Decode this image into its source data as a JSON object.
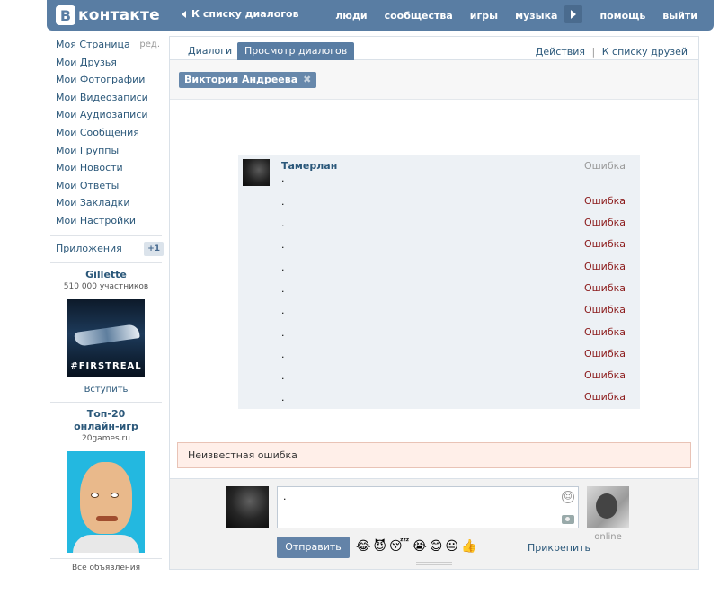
{
  "header": {
    "logo_letter": "В",
    "logo_text": "контакте",
    "back_label": "К списку диалогов",
    "nav": [
      "люди",
      "сообщества",
      "игры",
      "музыка",
      "помощь",
      "выйти"
    ]
  },
  "sidebar": {
    "items": [
      {
        "label": "Моя Страница"
      },
      {
        "label": "Мои Друзья"
      },
      {
        "label": "Мои Фотографии"
      },
      {
        "label": "Мои Видеозаписи"
      },
      {
        "label": "Мои Аудиозаписи"
      },
      {
        "label": "Мои Сообщения"
      },
      {
        "label": "Мои Группы"
      },
      {
        "label": "Мои Новости"
      },
      {
        "label": "Мои Ответы"
      },
      {
        "label": "Мои Закладки"
      },
      {
        "label": "Мои Настройки"
      }
    ],
    "edit_label": "ред.",
    "apps_label": "Приложения",
    "apps_count": "+1"
  },
  "ads": [
    {
      "title": "Gillette",
      "subtitle": "510 000 участников",
      "image_tag": "#FIRSTREAL",
      "link": "Вступить"
    },
    {
      "title": "Топ-20 онлайн-игр",
      "subtitle": "20games.ru"
    }
  ],
  "ads_footer": "Все объявления",
  "tabs": [
    {
      "label": "Диалоги",
      "active": false
    },
    {
      "label": "Просмотр диалогов",
      "active": true
    }
  ],
  "tab_actions": {
    "actions": "Действия",
    "separator": "|",
    "friends": "К списку друзей"
  },
  "peer": {
    "name": "Виктория Андреева",
    "remove": "✖"
  },
  "messages": {
    "author": "Тамерлан",
    "rows": [
      {
        "text": ".",
        "status": "Ошибка"
      },
      {
        "text": ".",
        "status": "Ошибка"
      },
      {
        "text": ".",
        "status": "Ошибка"
      },
      {
        "text": ".",
        "status": "Ошибка"
      },
      {
        "text": ".",
        "status": "Ошибка"
      },
      {
        "text": ".",
        "status": "Ошибка"
      },
      {
        "text": ".",
        "status": "Ошибка"
      },
      {
        "text": ".",
        "status": "Ошибка"
      },
      {
        "text": ".",
        "status": "Ошибка"
      },
      {
        "text": ".",
        "status": "Ошибка"
      },
      {
        "text": ".",
        "status": "Ошибка"
      }
    ]
  },
  "error_box": "Неизвестная ошибка",
  "compose": {
    "input_value": ".",
    "send_label": "Отправить",
    "attach_label": "Прикрепить",
    "peer_status": "online",
    "emojis": [
      "😂",
      "😈",
      "😴",
      "😭",
      "😄",
      "😐",
      "👍"
    ]
  },
  "colors": {
    "brand": "#597da3",
    "link": "#2b587a",
    "error": "#8b1a1a"
  }
}
